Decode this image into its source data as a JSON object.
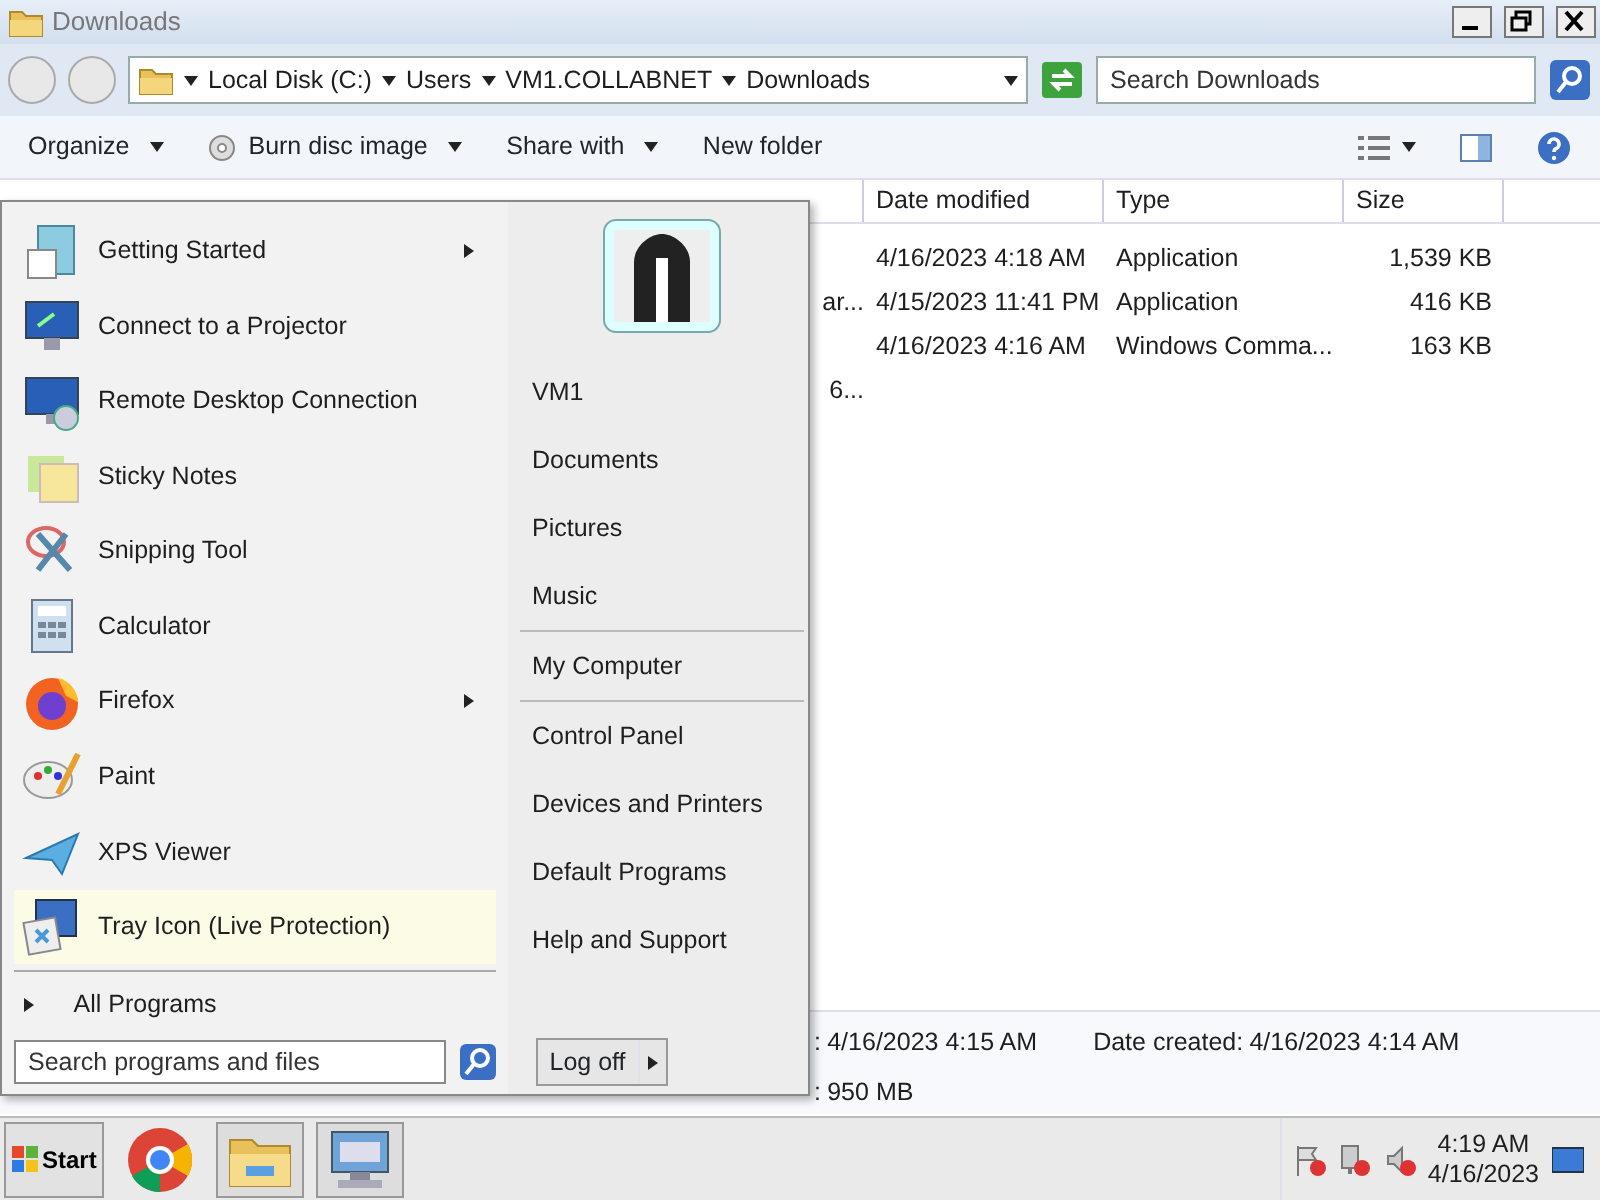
{
  "window": {
    "title": "Downloads"
  },
  "address": {
    "crumbs": [
      "Local Disk (C:)",
      "Users",
      "VM1.COLLABNET",
      "Downloads"
    ],
    "search_placeholder": "Search Downloads"
  },
  "toolbar": [
    {
      "label": "Organize",
      "dropdown": true
    },
    {
      "label": "Burn disc image",
      "dropdown": true
    },
    {
      "label": "Share with",
      "dropdown": true
    },
    {
      "label": "New folder",
      "dropdown": false
    }
  ],
  "file_list": {
    "columns": [
      "Date modified",
      "Type",
      "Size"
    ],
    "rows": [
      {
        "date": "4/16/2023 4:18 AM",
        "type": "Application",
        "size": "1,539 KB"
      },
      {
        "name": "ar...",
        "date": "4/15/2023 11:41 PM",
        "type": "Application",
        "size": "416 KB"
      },
      {
        "date": "4/16/2023 4:16 AM",
        "type": "Windows Comma...",
        "size": "163 KB"
      },
      {
        "name": "6..."
      }
    ]
  },
  "details": [
    {
      "label": ":",
      "value": "4/16/2023 4:15 AM"
    },
    {
      "label": "Date created:",
      "value": "4/16/2023 4:14 AM"
    },
    {
      "label": ":",
      "value": "950 MB"
    }
  ],
  "start_menu": {
    "programs": [
      {
        "label": "Getting Started",
        "submenu": true,
        "highlighted": false
      },
      {
        "label": "Connect to a Projector",
        "submenu": false,
        "highlighted": false
      },
      {
        "label": "Remote Desktop Connection",
        "submenu": false,
        "highlighted": false
      },
      {
        "label": "Sticky Notes",
        "submenu": false,
        "highlighted": false
      },
      {
        "label": "Snipping Tool",
        "submenu": false,
        "highlighted": false
      },
      {
        "label": "Calculator",
        "submenu": false,
        "highlighted": false
      },
      {
        "label": "Firefox",
        "submenu": true,
        "highlighted": false
      },
      {
        "label": "Paint",
        "submenu": false,
        "highlighted": false
      },
      {
        "label": "XPS Viewer",
        "submenu": false,
        "highlighted": false
      },
      {
        "label": "Tray Icon (Live Protection)",
        "submenu": false,
        "highlighted": true
      }
    ],
    "all_programs": "All Programs",
    "place_groups": [
      {
        "items": [
          "VM1",
          "Documents",
          "Pictures",
          "Music"
        ]
      },
      {
        "items": [
          "My Computer"
        ]
      },
      {
        "items": [
          "Control Panel",
          "Devices and Printers",
          "Default Programs",
          "Help and Support"
        ]
      }
    ],
    "search_placeholder": "Search programs and files",
    "logoff": "Log off"
  },
  "taskbar": {
    "start": "Start",
    "time": "4:19 AM",
    "date": "4/16/2023"
  }
}
